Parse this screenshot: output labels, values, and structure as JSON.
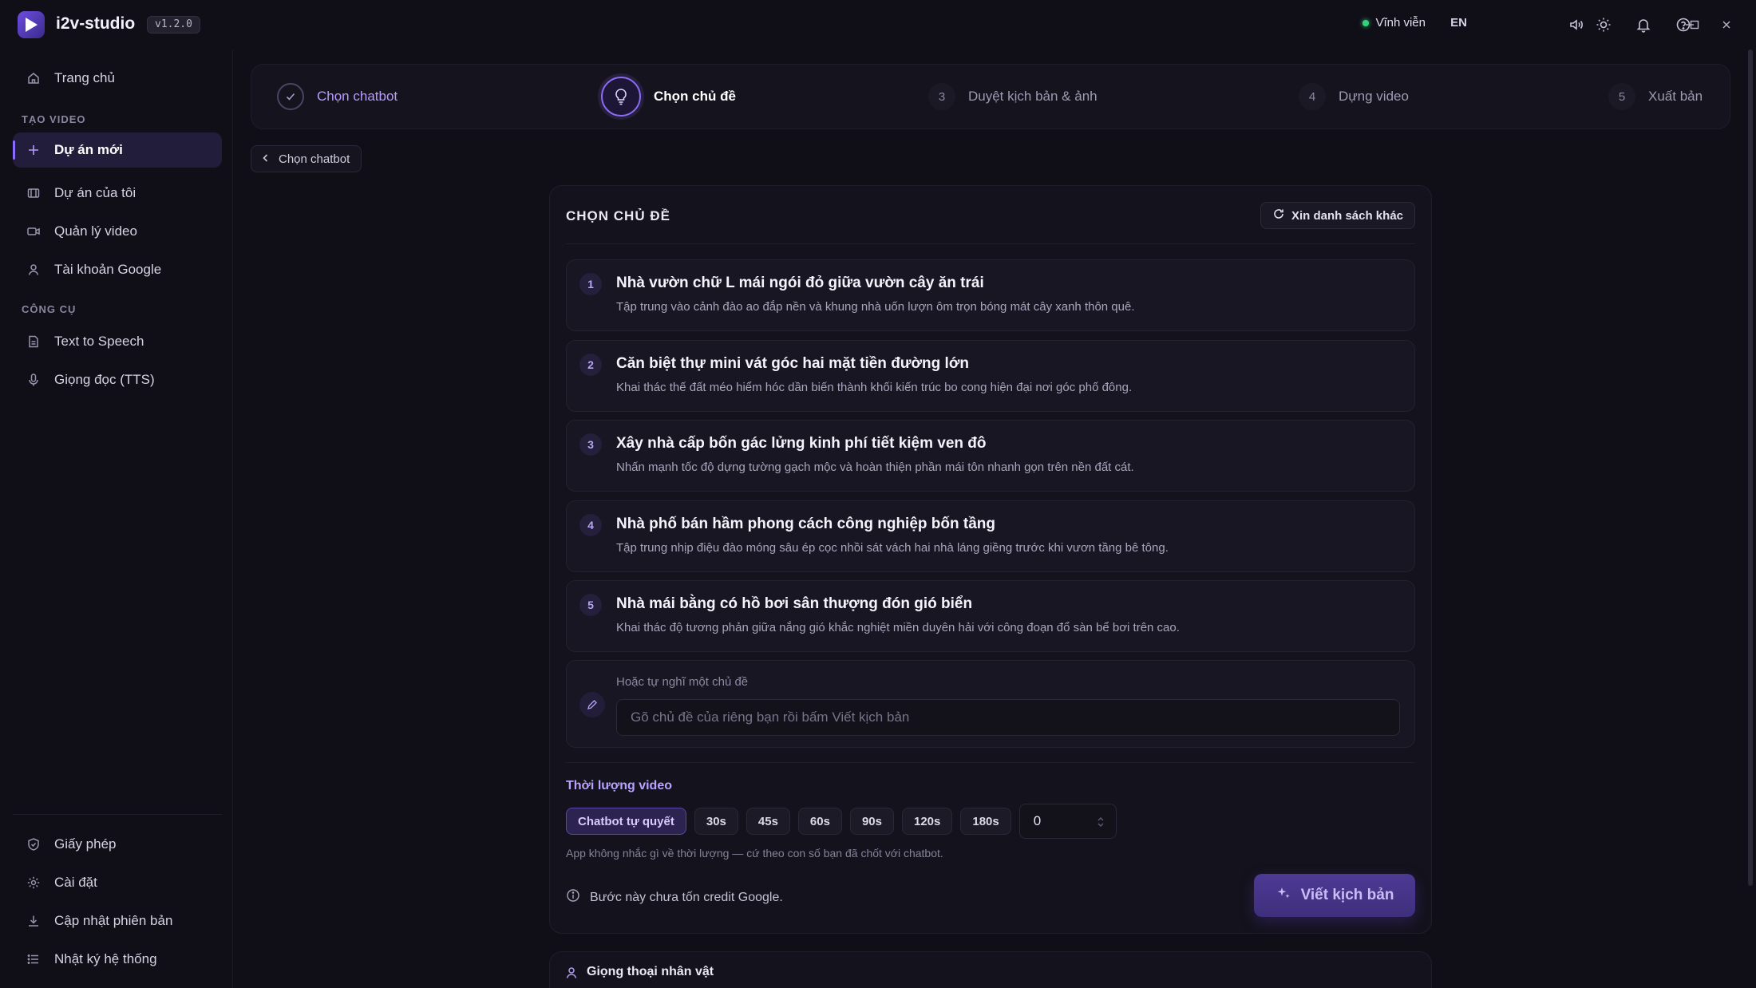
{
  "app": {
    "name": "i2v-studio",
    "version": "v1.2.0",
    "license": "Vĩnh viễn",
    "language": "EN"
  },
  "colors": {
    "accent": "#8a6bff",
    "license_dot": "#34d27b",
    "background": "#100f18"
  },
  "sidebar": {
    "home": "Trang chủ",
    "section_create": "TẠO VIDEO",
    "new_project": "Dự án mới",
    "my_projects": "Dự án của tôi",
    "manage_videos": "Quản lý video",
    "google_account": "Tài khoản Google",
    "section_tools": "CÔNG CỤ",
    "tts": "Text to Speech",
    "voices": "Giọng đọc (TTS)",
    "license": "Giấy phép",
    "settings": "Cài đặt",
    "update": "Cập nhật phiên bản",
    "logs": "Nhật ký hệ thống"
  },
  "stepper": [
    {
      "num": "1",
      "label": "Chọn chatbot",
      "state": "done"
    },
    {
      "num": "2",
      "label": "Chọn chủ đề",
      "state": "current"
    },
    {
      "num": "3",
      "label": "Duyệt kịch bản & ảnh",
      "state": "todo"
    },
    {
      "num": "4",
      "label": "Dựng video",
      "state": "todo"
    },
    {
      "num": "5",
      "label": "Xuất bản",
      "state": "todo"
    }
  ],
  "back_button": "Chọn chatbot",
  "panel": {
    "title": "CHỌN CHỦ ĐỀ",
    "refresh": "Xin danh sách khác",
    "topics": [
      {
        "num": "1",
        "title": "Nhà vườn chữ L mái ngói đỏ giữa vườn cây ăn trái",
        "desc": "Tập trung vào cảnh đào ao đắp nền và khung nhà uốn lượn ôm trọn bóng mát cây xanh thôn quê."
      },
      {
        "num": "2",
        "title": "Căn biệt thự mini vát góc hai mặt tiền đường lớn",
        "desc": "Khai thác thế đất méo hiểm hóc dần biến thành khối kiến trúc bo cong hiện đại nơi góc phố đông."
      },
      {
        "num": "3",
        "title": "Xây nhà cấp bốn gác lửng kinh phí tiết kiệm ven đô",
        "desc": "Nhấn mạnh tốc độ dựng tường gạch mộc và hoàn thiện phần mái tôn nhanh gọn trên nền đất cát."
      },
      {
        "num": "4",
        "title": "Nhà phố bán hầm phong cách công nghiệp bốn tầng",
        "desc": "Tập trung nhịp điệu đào móng sâu ép cọc nhồi sát vách hai nhà láng giềng trước khi vươn tầng bê tông."
      },
      {
        "num": "5",
        "title": "Nhà mái bằng có hồ bơi sân thượng đón gió biển",
        "desc": "Khai thác độ tương phản giữa nắng gió khắc nghiệt miền duyên hải với công đoạn đổ sàn bể bơi trên cao."
      }
    ],
    "custom_hint": "Hoặc tự nghĩ một chủ đề",
    "custom_placeholder": "Gõ chủ đề của riêng bạn rồi bấm Viết kịch bản",
    "duration_title": "Thời lượng video",
    "duration_options": [
      "Chatbot tự quyết",
      "30s",
      "45s",
      "60s",
      "90s",
      "120s",
      "180s"
    ],
    "duration_selected": "Chatbot tự quyết",
    "duration_custom_value": "0",
    "duration_note": "App không nhắc gì về thời lượng — cứ theo con số bạn đã chốt với chatbot.",
    "credit_note": "Bước này chưa tốn credit Google.",
    "write_button": "Viết kịch bản"
  },
  "voice_panel": {
    "title": "Giọng thoại nhân vật"
  }
}
